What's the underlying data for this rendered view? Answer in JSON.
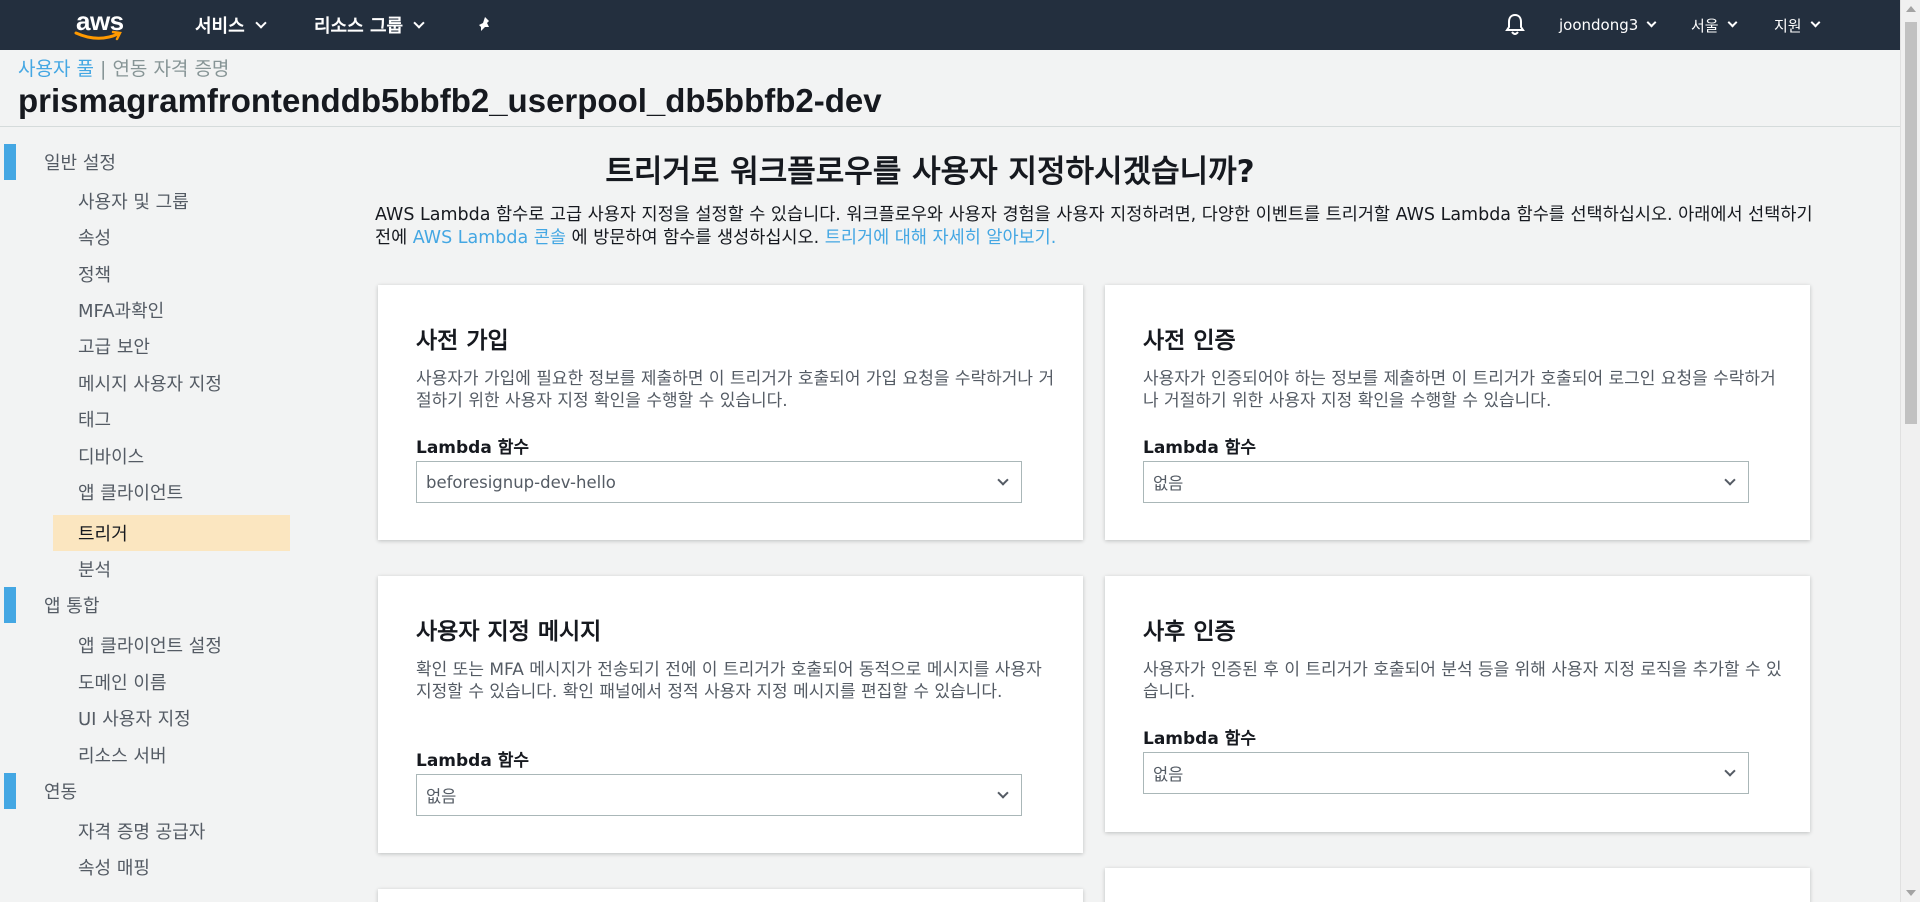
{
  "nav": {
    "logo": "aws",
    "services": "서비스",
    "resource_groups": "리소스 그룹",
    "pin_icon": "pin-icon",
    "bell_icon": "bell-icon",
    "user": "joondong3",
    "region": "서울",
    "support": "지원"
  },
  "header": {
    "breadcrumb_link": "사용자 풀",
    "breadcrumb_sep": " | ",
    "breadcrumb_current": "연동 자격 증명",
    "title": "prismagramfrontenddb5bbfb2_userpool_db5bbfb2-dev"
  },
  "sidebar": {
    "sections": [
      {
        "label": "일반 설정",
        "items": [
          "사용자 및 그룹",
          "속성",
          "정책",
          "MFA과확인",
          "고급 보안",
          "메시지 사용자 지정",
          "태그",
          "디바이스",
          "앱 클라이언트",
          "트리거",
          "분석"
        ]
      },
      {
        "label": "앱 통합",
        "items": [
          "앱 클라이언트 설정",
          "도메인 이름",
          "UI 사용자 지정",
          "리소스 서버"
        ]
      },
      {
        "label": "연동",
        "items": [
          "자격 증명 공급자",
          "속성 매핑"
        ]
      }
    ],
    "active_item": "트리거"
  },
  "main": {
    "heading": "트리거로 워크플로우를 사용자 지정하시겠습니까?",
    "intro_text": "AWS Lambda 함수로 고급 사용자 지정을 설정할 수 있습니다. 워크플로우와 사용자 경험을 사용자 지정하려면, 다양한 이벤트를 트리거할 AWS Lambda 함수를 선택하십시오. 아래에서 선택하기 전에 ",
    "intro_link": "AWS Lambda 콘솔",
    "intro_text2": " 에 방문하여 함수를 생성하십시오. ",
    "intro_learn_more": "트리거에 대해 자세히 알아보기.",
    "cards": [
      {
        "title": "사전 가입",
        "description": "사용자가 가입에 필요한 정보를 제출하면 이 트리거가 호출되어 가입 요청을 수락하거나 거절하기 위한 사용자 지정 확인을 수행할 수 있습니다.",
        "field_label": "Lambda 함수",
        "selected": "beforesignup-dev-hello"
      },
      {
        "title": "사전 인증",
        "description": "사용자가 인증되어야 하는 정보를 제출하면 이 트리거가 호출되어 로그인 요청을 수락하거나 거절하기 위한 사용자 지정 확인을 수행할 수 있습니다.",
        "field_label": "Lambda 함수",
        "selected": "없음"
      },
      {
        "title": "사용자 지정 메시지",
        "description": "확인 또는 MFA 메시지가 전송되기 전에 이 트리거가 호출되어 동적으로 메시지를 사용자 지정할 수 있습니다. 확인 패널에서 정적 사용자 지정 메시지를 편집할 수 있습니다.",
        "field_label": "Lambda 함수",
        "selected": "없음"
      },
      {
        "title": "사후 인증",
        "description": "사용자가 인증된 후 이 트리거가 호출되어 분석 등을 위해 사용자 지정 로직을 추가할 수 있습니다.",
        "field_label": "Lambda 함수",
        "selected": "없음"
      }
    ]
  },
  "colors": {
    "nav_bg": "#232f3e",
    "accent_blue": "#44a7e3",
    "active_bg": "#fbe6c0",
    "page_bg": "#f2f3f3"
  }
}
